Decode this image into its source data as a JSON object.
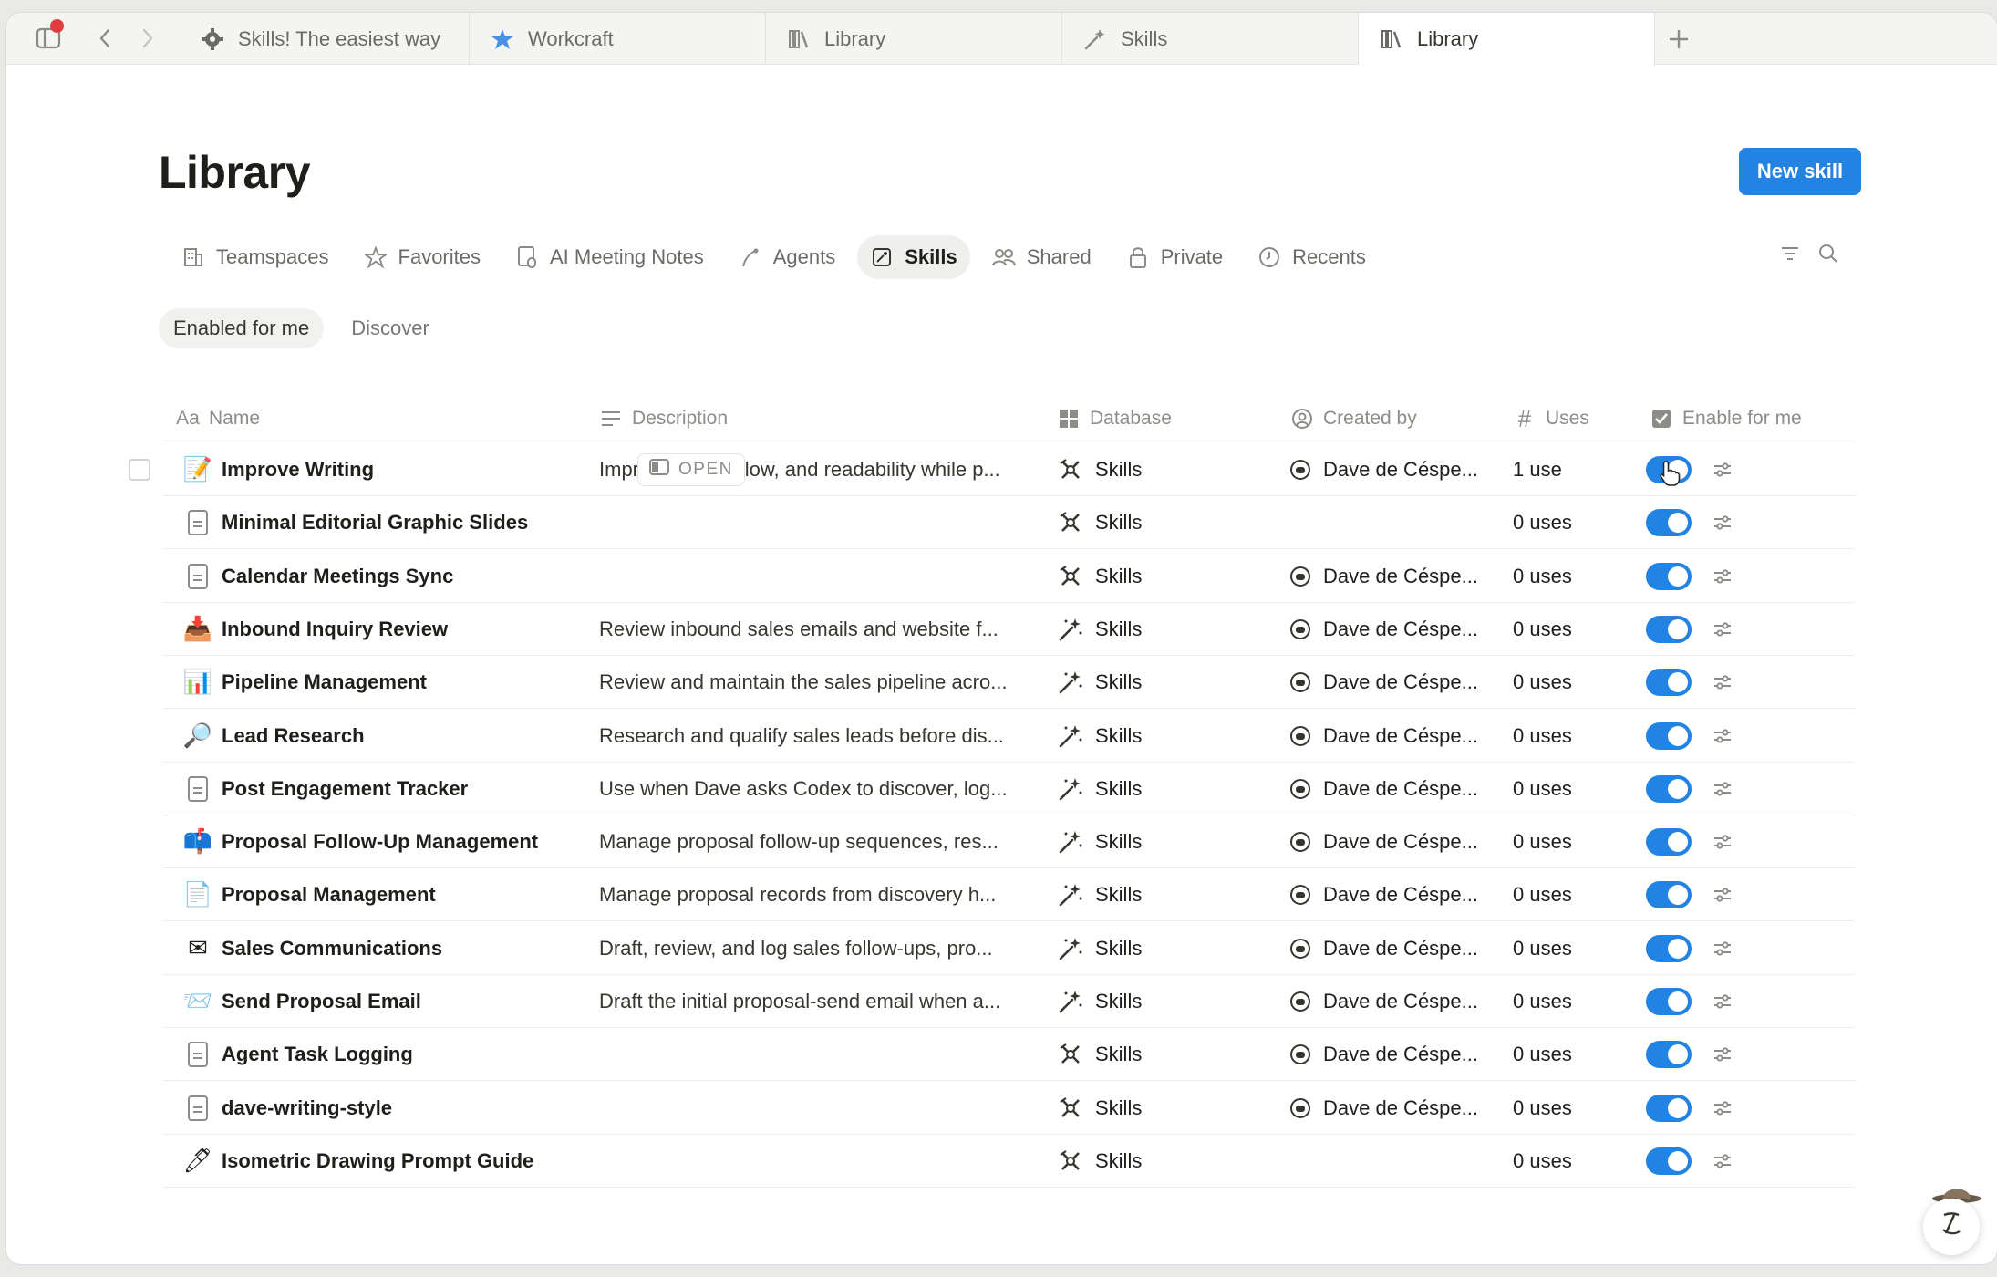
{
  "tabs": [
    {
      "label": "Skills! The easiest way",
      "icon": "gear-icon"
    },
    {
      "label": "Workcraft",
      "icon": "star-filled-icon"
    },
    {
      "label": "Library",
      "icon": "library-icon"
    },
    {
      "label": "Skills",
      "icon": "magic-wand-icon"
    },
    {
      "label": "Library",
      "icon": "library-icon",
      "active": true
    }
  ],
  "page": {
    "title": "Library",
    "new_button": "New skill"
  },
  "nav": [
    {
      "label": "Teamspaces",
      "icon": "building-icon"
    },
    {
      "label": "Favorites",
      "icon": "star-icon"
    },
    {
      "label": "AI Meeting Notes",
      "icon": "meeting-notes-icon"
    },
    {
      "label": "Agents",
      "icon": "agent-icon"
    },
    {
      "label": "Skills",
      "icon": "skills-icon",
      "active": true
    },
    {
      "label": "Shared",
      "icon": "people-icon"
    },
    {
      "label": "Private",
      "icon": "lock-icon"
    },
    {
      "label": "Recents",
      "icon": "clock-icon"
    }
  ],
  "subtabs": [
    {
      "label": "Enabled for me",
      "active": true
    },
    {
      "label": "Discover"
    }
  ],
  "columns": {
    "name": "Name",
    "description": "Description",
    "database": "Database",
    "created_by": "Created by",
    "uses": "Uses",
    "enable": "Enable for me"
  },
  "open_label": "OPEN",
  "rows": [
    {
      "icon": "📝",
      "name": "Improve Writing",
      "description": "Improve clarity, flow, and readability while p...",
      "database": "Skills",
      "db_icon": "skills-cross-icon",
      "creator": "Dave de Céspe...",
      "uses": "1 use",
      "enabled": true
    },
    {
      "icon": "doc",
      "name": "Minimal Editorial Graphic Slides",
      "description": "",
      "database": "Skills",
      "db_icon": "skills-cross-icon",
      "creator": "",
      "uses": "0 uses",
      "enabled": true
    },
    {
      "icon": "doc",
      "name": "Calendar Meetings Sync",
      "description": "",
      "database": "Skills",
      "db_icon": "skills-cross-icon",
      "creator": "Dave de Céspe...",
      "uses": "0 uses",
      "enabled": true
    },
    {
      "icon": "📥",
      "name": "Inbound Inquiry Review",
      "description": "Review inbound sales emails and website f...",
      "database": "Skills",
      "db_icon": "magic-wand-icon",
      "creator": "Dave de Céspe...",
      "uses": "0 uses",
      "enabled": true
    },
    {
      "icon": "📊",
      "name": "Pipeline Management",
      "description": "Review and maintain the sales pipeline acro...",
      "database": "Skills",
      "db_icon": "magic-wand-icon",
      "creator": "Dave de Céspe...",
      "uses": "0 uses",
      "enabled": true
    },
    {
      "icon": "🔎",
      "name": "Lead Research",
      "description": "Research and qualify sales leads before dis...",
      "database": "Skills",
      "db_icon": "magic-wand-icon",
      "creator": "Dave de Céspe...",
      "uses": "0 uses",
      "enabled": true
    },
    {
      "icon": "doc",
      "name": "Post Engagement Tracker",
      "description": "Use when Dave asks Codex to discover, log...",
      "database": "Skills",
      "db_icon": "magic-wand-icon",
      "creator": "Dave de Céspe...",
      "uses": "0 uses",
      "enabled": true
    },
    {
      "icon": "📫",
      "name": "Proposal Follow-Up Management",
      "description": "Manage proposal follow-up sequences, res...",
      "database": "Skills",
      "db_icon": "magic-wand-icon",
      "creator": "Dave de Céspe...",
      "uses": "0 uses",
      "enabled": true
    },
    {
      "icon": "📄",
      "name": "Proposal Management",
      "description": "Manage proposal records from discovery h...",
      "database": "Skills",
      "db_icon": "magic-wand-icon",
      "creator": "Dave de Céspe...",
      "uses": "0 uses",
      "enabled": true
    },
    {
      "icon": "✉",
      "name": "Sales Communications",
      "description": "Draft, review, and log sales follow-ups, pro...",
      "database": "Skills",
      "db_icon": "magic-wand-icon",
      "creator": "Dave de Céspe...",
      "uses": "0 uses",
      "enabled": true
    },
    {
      "icon": "📨",
      "name": "Send Proposal Email",
      "description": "Draft the initial proposal-send email when a...",
      "database": "Skills",
      "db_icon": "magic-wand-icon",
      "creator": "Dave de Céspe...",
      "uses": "0 uses",
      "enabled": true
    },
    {
      "icon": "doc",
      "name": "Agent Task Logging",
      "description": "",
      "database": "Skills",
      "db_icon": "skills-cross-icon",
      "creator": "Dave de Céspe...",
      "uses": "0 uses",
      "enabled": true
    },
    {
      "icon": "doc",
      "name": "dave-writing-style",
      "description": "",
      "database": "Skills",
      "db_icon": "skills-cross-icon",
      "creator": "Dave de Céspe...",
      "uses": "0 uses",
      "enabled": true
    },
    {
      "icon": "🖊",
      "name": "Isometric Drawing Prompt Guide",
      "description": "",
      "database": "Skills",
      "db_icon": "skills-cross-icon",
      "creator": "",
      "uses": "0 uses",
      "enabled": true
    }
  ],
  "colors": {
    "accent": "#2383e2",
    "text": "#37352f",
    "muted": "#8d8c88"
  }
}
